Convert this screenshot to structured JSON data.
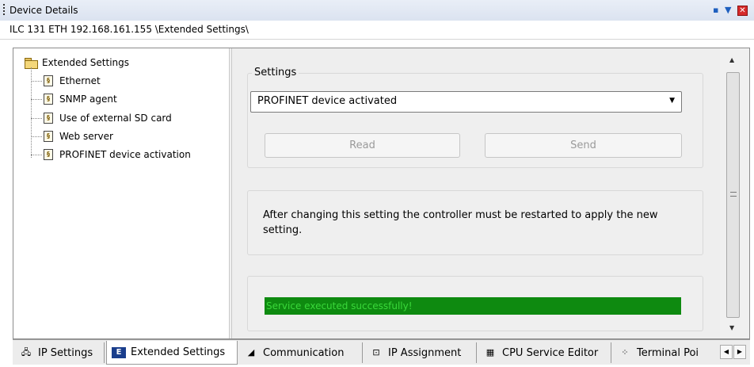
{
  "window": {
    "title": "Device Details",
    "path": "ILC 131 ETH 192.168.161.155 \\Extended Settings\\"
  },
  "tree": {
    "root": "Extended Settings",
    "items": [
      "Ethernet",
      "SNMP agent",
      "Use of external SD card",
      "Web server",
      "PROFINET device activation"
    ]
  },
  "settings": {
    "legend": "Settings",
    "combo_value": "PROFINET device activated",
    "read_label": "Read",
    "send_label": "Send"
  },
  "note": "After changing this setting the controller must be restarted to apply the new setting.",
  "status": {
    "text": "Service executed successfully!",
    "color": "#0e8a10"
  },
  "tabs": [
    {
      "label": "IP Settings",
      "icon": "network-icon"
    },
    {
      "label": "Extended Settings",
      "icon": "extended-settings-icon"
    },
    {
      "label": "Communication",
      "icon": "communication-icon"
    },
    {
      "label": "IP Assignment",
      "icon": "ip-assignment-icon"
    },
    {
      "label": "CPU Service Editor",
      "icon": "cpu-service-icon"
    },
    {
      "label": "Terminal Poi",
      "icon": "terminal-points-icon"
    }
  ]
}
